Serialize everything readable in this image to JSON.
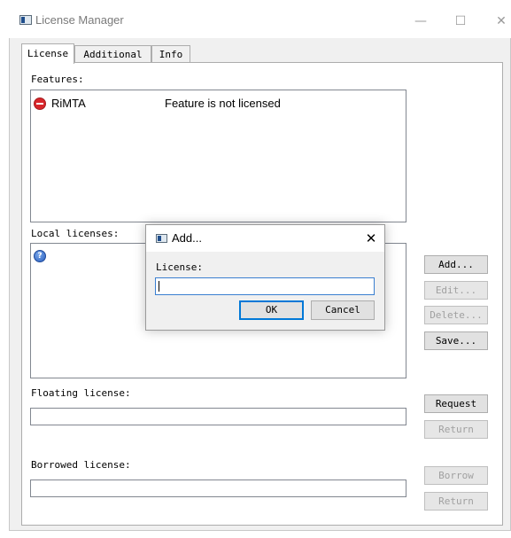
{
  "window": {
    "title": "License Manager",
    "controls": {
      "minimize": "—",
      "maximize": "☐",
      "close": "✕"
    }
  },
  "tabs": [
    {
      "label": "License",
      "active": true
    },
    {
      "label": "Additional",
      "active": false
    },
    {
      "label": "Info",
      "active": false
    }
  ],
  "features": {
    "label": "Features:",
    "items": [
      {
        "icon": "no-entry-icon",
        "name": "RiMTA",
        "status": "Feature is not licensed"
      }
    ]
  },
  "local_licenses": {
    "label": "Local licenses:",
    "icon": "info-icon",
    "buttons": {
      "add": "Add...",
      "edit": "Edit...",
      "delete": "Delete...",
      "save": "Save..."
    }
  },
  "floating_license": {
    "label": "Floating license:",
    "value": "",
    "buttons": {
      "request": "Request",
      "return": "Return"
    }
  },
  "borrowed_license": {
    "label": "Borrowed license:",
    "value": "",
    "buttons": {
      "borrow": "Borrow",
      "return": "Return"
    }
  },
  "add_dialog": {
    "title": "Add...",
    "close": "✕",
    "field_label": "License:",
    "value": "",
    "ok": "OK",
    "cancel": "Cancel"
  },
  "colors": {
    "accent": "#3a7fd0",
    "error": "#d8262b",
    "info": "#2a5fc0"
  }
}
